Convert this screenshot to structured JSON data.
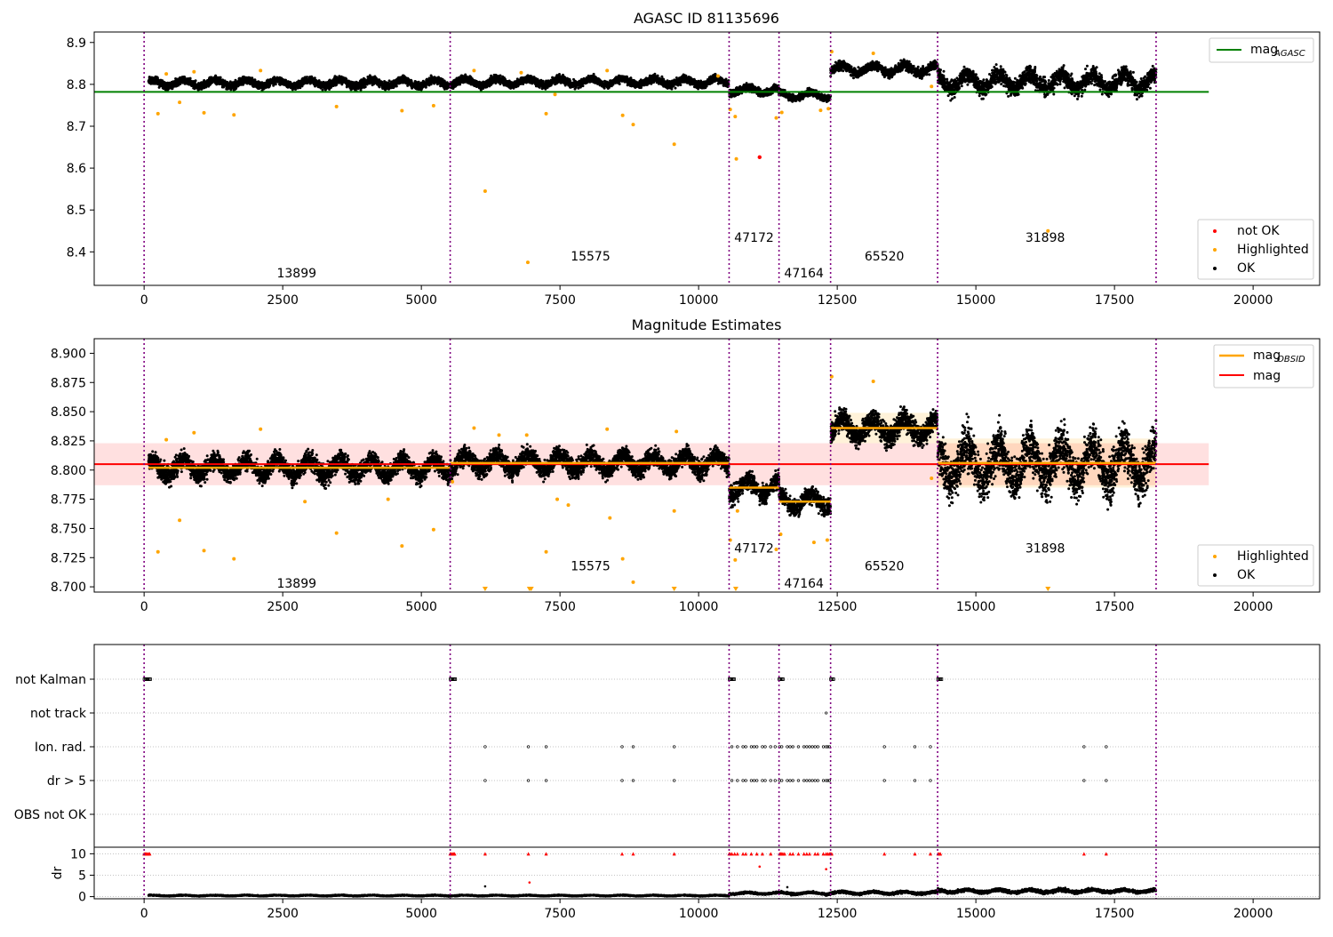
{
  "chart_data": [
    {
      "type": "scatter",
      "title": "AGASC ID 81135696",
      "xlim": [
        -900,
        21200
      ],
      "ylim": [
        8.32,
        8.925
      ],
      "x_ticks": [
        0,
        2500,
        5000,
        7500,
        10000,
        12500,
        15000,
        17500,
        20000
      ],
      "y_ticks": [
        8.4,
        8.5,
        8.6,
        8.7,
        8.8,
        8.9
      ],
      "y_tick_labels": [
        "8.4",
        "8.5",
        "8.6",
        "8.7",
        "8.8",
        "8.9"
      ],
      "obs_boundaries": [
        0,
        5520,
        10550,
        11450,
        12380,
        14310,
        18250
      ],
      "obs_labels": [
        {
          "text": "13899",
          "x": 2750,
          "y": 8.35
        },
        {
          "text": "15575",
          "x": 8050,
          "y": 8.39
        },
        {
          "text": "47172",
          "x": 11000,
          "y": 8.435
        },
        {
          "text": "47164",
          "x": 11900,
          "y": 8.35
        },
        {
          "text": "65520",
          "x": 13350,
          "y": 8.39
        },
        {
          "text": "31898",
          "x": 16250,
          "y": 8.435
        }
      ],
      "segments": [
        {
          "x0": 80,
          "x1": 5520,
          "mean": 8.803,
          "spread": 0.012
        },
        {
          "x0": 5520,
          "x1": 10550,
          "mean": 8.806,
          "spread": 0.012
        },
        {
          "x0": 10550,
          "x1": 11450,
          "mean": 8.786,
          "spread": 0.012
        },
        {
          "x0": 11450,
          "x1": 12380,
          "mean": 8.774,
          "spread": 0.012
        },
        {
          "x0": 12380,
          "x1": 14310,
          "mean": 8.836,
          "spread": 0.015
        },
        {
          "x0": 14310,
          "x1": 18250,
          "mean": 8.806,
          "spread": 0.028
        }
      ],
      "hlines": [
        {
          "name": "mag_AGASC",
          "y": 8.782,
          "x0": -900,
          "x1": 19200,
          "color": "#008000"
        }
      ],
      "highlighted_points": [
        [
          250,
          8.73
        ],
        [
          640,
          8.757
        ],
        [
          1080,
          8.732
        ],
        [
          1620,
          8.727
        ],
        [
          3470,
          8.747
        ],
        [
          4650,
          8.737
        ],
        [
          5220,
          8.749
        ],
        [
          6150,
          8.545
        ],
        [
          6920,
          8.375
        ],
        [
          7250,
          8.73
        ],
        [
          7410,
          8.776
        ],
        [
          8630,
          8.726
        ],
        [
          8820,
          8.704
        ],
        [
          9560,
          8.657
        ],
        [
          10570,
          8.74
        ],
        [
          10660,
          8.723
        ],
        [
          10680,
          8.622
        ],
        [
          11400,
          8.72
        ],
        [
          11500,
          8.733
        ],
        [
          12200,
          8.738
        ],
        [
          12340,
          8.742
        ],
        [
          14200,
          8.795
        ],
        [
          400,
          8.825
        ],
        [
          900,
          8.83
        ],
        [
          2100,
          8.833
        ],
        [
          5950,
          8.833
        ],
        [
          6800,
          8.828
        ],
        [
          8350,
          8.833
        ],
        [
          10350,
          8.82
        ],
        [
          12400,
          8.878
        ],
        [
          13150,
          8.874
        ],
        [
          16300,
          8.45
        ]
      ],
      "not_ok_points": [
        [
          11100,
          8.626
        ]
      ],
      "legends": [
        {
          "items": [
            {
              "label": "mag",
              "sub": "AGASC",
              "marker": "line",
              "color": "#008000"
            }
          ]
        },
        {
          "items": [
            {
              "label": "not OK",
              "marker": "dot",
              "color": "#ff0000"
            },
            {
              "label": "Highlighted",
              "marker": "dot",
              "color": "#ffa500"
            },
            {
              "label": "OK",
              "marker": "dot",
              "color": "#000000"
            }
          ]
        }
      ]
    },
    {
      "type": "scatter",
      "title": "Magnitude Estimates",
      "xlim": [
        -900,
        21200
      ],
      "ylim": [
        8.6955,
        8.9125
      ],
      "x_ticks": [
        0,
        2500,
        5000,
        7500,
        10000,
        12500,
        15000,
        17500,
        20000
      ],
      "y_ticks": [
        8.7,
        8.725,
        8.75,
        8.775,
        8.8,
        8.825,
        8.85,
        8.875,
        8.9
      ],
      "y_tick_labels": [
        "8.700",
        "8.725",
        "8.750",
        "8.775",
        "8.800",
        "8.825",
        "8.850",
        "8.875",
        "8.900"
      ],
      "obs_boundaries": [
        0,
        5520,
        10550,
        11450,
        12380,
        14310,
        18250
      ],
      "obs_labels": [
        {
          "text": "13899",
          "x": 2750,
          "y": 8.703
        },
        {
          "text": "15575",
          "x": 8050,
          "y": 8.718
        },
        {
          "text": "47172",
          "x": 11000,
          "y": 8.733
        },
        {
          "text": "47164",
          "x": 11900,
          "y": 8.703
        },
        {
          "text": "65520",
          "x": 13350,
          "y": 8.718
        },
        {
          "text": "31898",
          "x": 16250,
          "y": 8.733
        }
      ],
      "segments": [
        {
          "x0": 80,
          "x1": 5520,
          "mean": 8.802,
          "spread": 0.011
        },
        {
          "x0": 5520,
          "x1": 10550,
          "mean": 8.806,
          "spread": 0.011
        },
        {
          "x0": 10550,
          "x1": 11450,
          "mean": 8.785,
          "spread": 0.011
        },
        {
          "x0": 11450,
          "x1": 12380,
          "mean": 8.773,
          "spread": 0.01
        },
        {
          "x0": 12380,
          "x1": 14310,
          "mean": 8.836,
          "spread": 0.013
        },
        {
          "x0": 14310,
          "x1": 18250,
          "mean": 8.806,
          "spread": 0.026
        }
      ],
      "obsid_means": [
        {
          "x0": 80,
          "x1": 5520,
          "y": 8.802
        },
        {
          "x0": 5520,
          "x1": 10550,
          "y": 8.806
        },
        {
          "x0": 10550,
          "x1": 11450,
          "y": 8.785
        },
        {
          "x0": 11450,
          "x1": 12380,
          "y": 8.773
        },
        {
          "x0": 12380,
          "x1": 14310,
          "y": 8.836
        },
        {
          "x0": 14310,
          "x1": 18250,
          "y": 8.806
        }
      ],
      "mag_line": {
        "y": 8.805,
        "x0": -900,
        "x1": 19200,
        "band": [
          8.787,
          8.823
        ]
      },
      "obsid_bands": [
        {
          "x0": 12380,
          "x1": 14310,
          "band": [
            8.823,
            8.849
          ]
        },
        {
          "x0": 14310,
          "x1": 18250,
          "band": [
            8.785,
            8.827
          ]
        }
      ],
      "highlighted_points": [
        [
          250,
          8.73
        ],
        [
          640,
          8.757
        ],
        [
          1080,
          8.731
        ],
        [
          1620,
          8.724
        ],
        [
          3470,
          8.746
        ],
        [
          4650,
          8.735
        ],
        [
          5220,
          8.749
        ],
        [
          5560,
          8.79
        ],
        [
          5950,
          8.836
        ],
        [
          6400,
          8.83
        ],
        [
          6900,
          8.83
        ],
        [
          7250,
          8.73
        ],
        [
          7450,
          8.775
        ],
        [
          7650,
          8.77
        ],
        [
          8350,
          8.835
        ],
        [
          8400,
          8.759
        ],
        [
          8630,
          8.724
        ],
        [
          8820,
          8.704
        ],
        [
          9560,
          8.765
        ],
        [
          9600,
          8.833
        ],
        [
          10570,
          8.74
        ],
        [
          10660,
          8.723
        ],
        [
          10700,
          8.765
        ],
        [
          11400,
          8.732
        ],
        [
          11480,
          8.745
        ],
        [
          12080,
          8.738
        ],
        [
          12320,
          8.74
        ],
        [
          12400,
          8.88
        ],
        [
          13150,
          8.876
        ],
        [
          14200,
          8.793
        ],
        [
          400,
          8.826
        ],
        [
          900,
          8.832
        ],
        [
          2100,
          8.835
        ],
        [
          2900,
          8.773
        ],
        [
          4400,
          8.775
        ]
      ],
      "offscale_markers": [
        6150,
        6950,
        6980,
        9560,
        10670,
        16300
      ],
      "legends": [
        {
          "items": [
            {
              "label": "mag",
              "sub": "OBSID",
              "marker": "line",
              "color": "#ffa500"
            },
            {
              "label": "mag",
              "marker": "line",
              "color": "#ff0000"
            }
          ]
        },
        {
          "items": [
            {
              "label": "Highlighted",
              "marker": "dot",
              "color": "#ffa500"
            },
            {
              "label": "OK",
              "marker": "dot",
              "color": "#000000"
            }
          ]
        }
      ]
    },
    {
      "type": "scatter",
      "title": "",
      "xlim": [
        -900,
        21200
      ],
      "x_ticks": [
        0,
        2500,
        5000,
        7500,
        10000,
        12500,
        15000,
        17500,
        20000
      ],
      "categories": [
        "not Kalman",
        "not track",
        "Ion. rad.",
        "dr > 5",
        "OBS not OK"
      ],
      "obs_boundaries": [
        0,
        5520,
        10550,
        11450,
        12380,
        14310,
        18250
      ],
      "not_kalman_x": [
        0,
        20,
        40,
        60,
        80,
        100,
        5520,
        5540,
        5560,
        5580,
        5600,
        10550,
        10570,
        10590,
        10610,
        10630,
        11450,
        11470,
        11490,
        11510,
        12380,
        12400,
        12420,
        14310,
        14330,
        14350,
        14370
      ],
      "not_track_x": [
        12300
      ],
      "ion_rad_x": [
        6150,
        6930,
        7250,
        8620,
        8820,
        9560,
        10600,
        10700,
        10800,
        10850,
        10950,
        11000,
        11050,
        11150,
        11200,
        11300,
        11380,
        11460,
        11500,
        11600,
        11650,
        11700,
        11800,
        11900,
        11950,
        12000,
        12050,
        12100,
        12150,
        12250,
        12300,
        12330,
        12360,
        13350,
        13900,
        14180,
        16950,
        17350
      ],
      "dr": {
        "ylim": [
          -0.5,
          10.7
        ],
        "y_ticks": [
          0,
          5,
          10
        ],
        "ylabel": "dr",
        "segments": [
          {
            "x0": 80,
            "x1": 5520,
            "mean": 0.25,
            "spread": 0.15
          },
          {
            "x0": 5520,
            "x1": 10550,
            "mean": 0.25,
            "spread": 0.15
          },
          {
            "x0": 10550,
            "x1": 11450,
            "mean": 0.8,
            "spread": 0.3
          },
          {
            "x0": 11450,
            "x1": 12380,
            "mean": 0.8,
            "spread": 0.35
          },
          {
            "x0": 12380,
            "x1": 14310,
            "mean": 0.9,
            "spread": 0.4
          },
          {
            "x0": 14310,
            "x1": 18250,
            "mean": 1.3,
            "spread": 0.5
          }
        ],
        "red_x": [
          0,
          20,
          40,
          60,
          80,
          100,
          5520,
          5540,
          5560,
          5580,
          5600,
          6150,
          6930,
          7250,
          8620,
          8820,
          9560,
          10550,
          10570,
          10600,
          10650,
          10700,
          10800,
          10850,
          10950,
          11050,
          11150,
          11300,
          11460,
          11480,
          11500,
          11520,
          11550,
          11650,
          11700,
          11800,
          11900,
          11950,
          12000,
          12100,
          12150,
          12250,
          12300,
          12330,
          12360,
          12380,
          12400,
          13350,
          13900,
          14180,
          14320,
          14340,
          14360,
          16950,
          17350
        ],
        "red_other": [
          [
            11100,
            7.0
          ],
          [
            6950,
            3.3
          ],
          [
            12300,
            6.4
          ]
        ],
        "black_outliers": [
          [
            6150,
            2.4
          ],
          [
            11600,
            2.2
          ]
        ]
      }
    }
  ]
}
